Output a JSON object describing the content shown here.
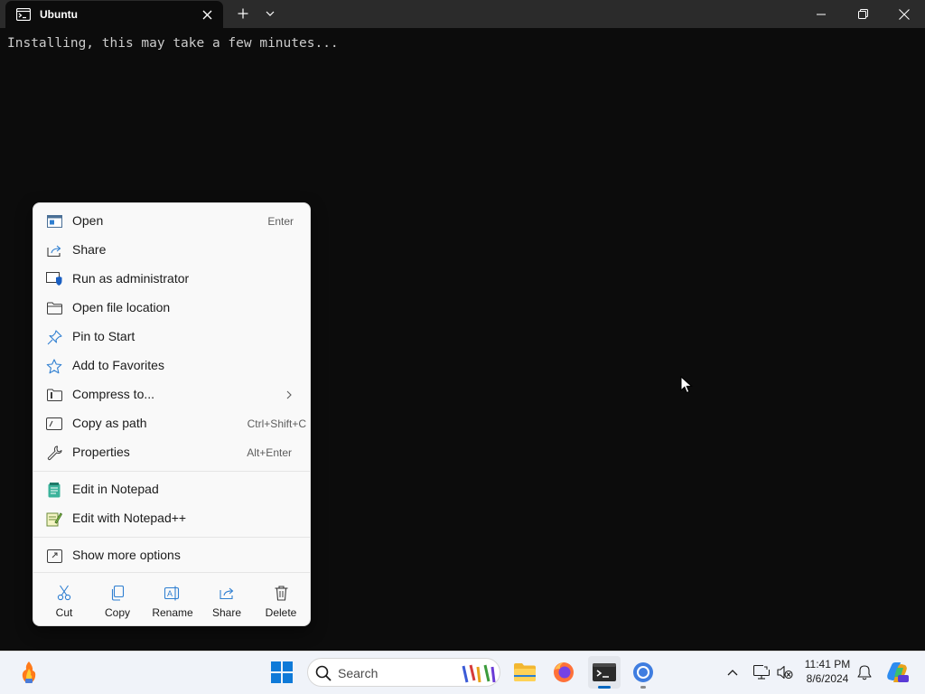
{
  "window": {
    "tab_title": "Ubuntu",
    "tab_icon": "terminal-icon",
    "new_tab_icon": "plus-icon",
    "dropdown_icon": "chevron-down-icon",
    "minimize_icon": "minimize-icon",
    "restore_icon": "restore-icon",
    "close_icon": "close-icon"
  },
  "terminal": {
    "output": "Installing, this may take a few minutes..."
  },
  "context_menu": {
    "items": [
      {
        "label": "Open",
        "shortcut": "Enter",
        "icon": "open-app-icon"
      },
      {
        "label": "Share",
        "shortcut": "",
        "icon": "share-icon"
      },
      {
        "label": "Run as administrator",
        "shortcut": "",
        "icon": "shield-icon"
      },
      {
        "label": "Open file location",
        "shortcut": "",
        "icon": "folder-icon"
      },
      {
        "label": "Pin to Start",
        "shortcut": "",
        "icon": "pin-icon"
      },
      {
        "label": "Add to Favorites",
        "shortcut": "",
        "icon": "star-icon"
      },
      {
        "label": "Compress to...",
        "shortcut": "",
        "icon": "zip-folder-icon",
        "submenu": true
      },
      {
        "label": "Copy as path",
        "shortcut": "Ctrl+Shift+C",
        "icon": "copy-path-icon"
      },
      {
        "label": "Properties",
        "shortcut": "Alt+Enter",
        "icon": "wrench-icon"
      },
      {
        "label": "Edit in Notepad",
        "shortcut": "",
        "icon": "notepad-icon"
      },
      {
        "label": "Edit with Notepad++",
        "shortcut": "",
        "icon": "notepad-plus-icon"
      },
      {
        "label": "Show more options",
        "shortcut": "",
        "icon": "more-options-icon"
      }
    ],
    "quick_actions": [
      {
        "label": "Cut",
        "icon": "scissors-icon"
      },
      {
        "label": "Copy",
        "icon": "copy-icon"
      },
      {
        "label": "Rename",
        "icon": "rename-icon"
      },
      {
        "label": "Share",
        "icon": "share-icon"
      },
      {
        "label": "Delete",
        "icon": "trash-icon"
      }
    ]
  },
  "taskbar": {
    "search_placeholder": "Search",
    "apps": [
      "widgets-icon",
      "start-icon",
      "file-explorer-icon",
      "firefox-icon",
      "terminal-icon",
      "chrome-icon"
    ],
    "tray": [
      "chevron-up-icon",
      "network-icon",
      "volume-muted-icon",
      "notification-bell-icon",
      "copilot-icon"
    ],
    "time": "11:41 PM",
    "date": "8/6/2024"
  },
  "colors": {
    "terminal_bg": "#0c0c0c",
    "terminal_text": "#cccccc",
    "titlebar_bg": "#2b2b2b",
    "menu_bg": "#f9f9f9",
    "accent": "#0067c0",
    "taskbar_bg": "#f0f3f9"
  }
}
